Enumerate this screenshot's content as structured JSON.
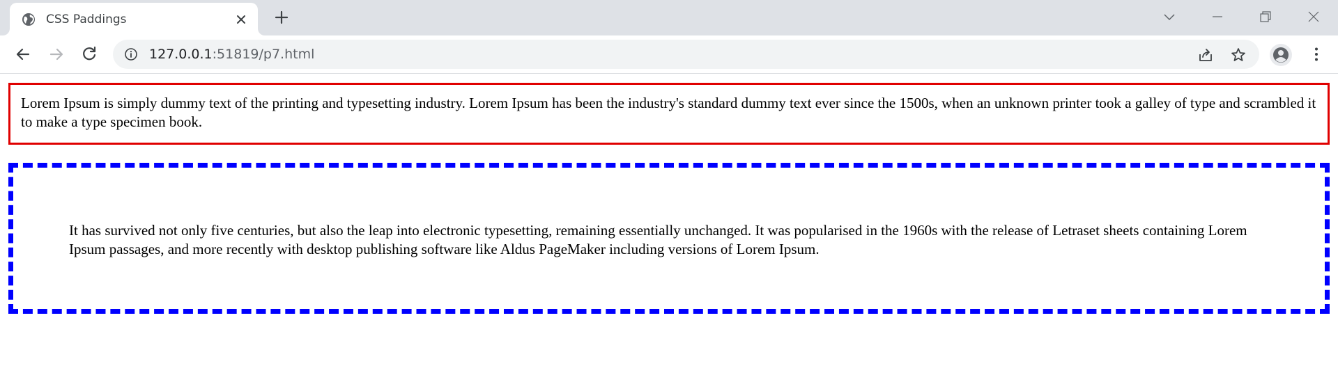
{
  "browser": {
    "tab": {
      "title": "CSS Paddings",
      "favicon": "globe-icon",
      "close_icon": "close-icon"
    },
    "new_tab_icon": "plus-icon",
    "window_controls": [
      "chevron-down-icon",
      "minimize-icon",
      "restore-icon",
      "close-icon"
    ],
    "toolbar": {
      "back_icon": "back-arrow-icon",
      "forward_icon": "forward-arrow-icon",
      "reload_icon": "reload-icon",
      "site_info_icon": "info-icon",
      "url_host": "127.0.0.1",
      "url_path": ":51819/p7.html",
      "share_icon": "share-icon",
      "bookmark_icon": "star-icon",
      "profile_icon": "profile-icon",
      "menu_icon": "kebab-menu-icon"
    }
  },
  "page": {
    "paragraph1": "Lorem Ipsum is simply dummy text of the printing and typesetting industry. Lorem Ipsum has been the industry's standard dummy text ever since the 1500s, when an unknown printer took a galley of type and scrambled it to make a type specimen book.",
    "paragraph2": "It has survived not only five centuries, but also the leap into electronic typesetting, remaining essentially unchanged. It was popularised in the 1960s with the release of Letraset sheets containing Lorem Ipsum passages, and more recently with desktop publishing software like Aldus PageMaker including versions of Lorem Ipsum."
  },
  "colors": {
    "box1_border": "#e00000",
    "box2_border": "#0000ff"
  }
}
